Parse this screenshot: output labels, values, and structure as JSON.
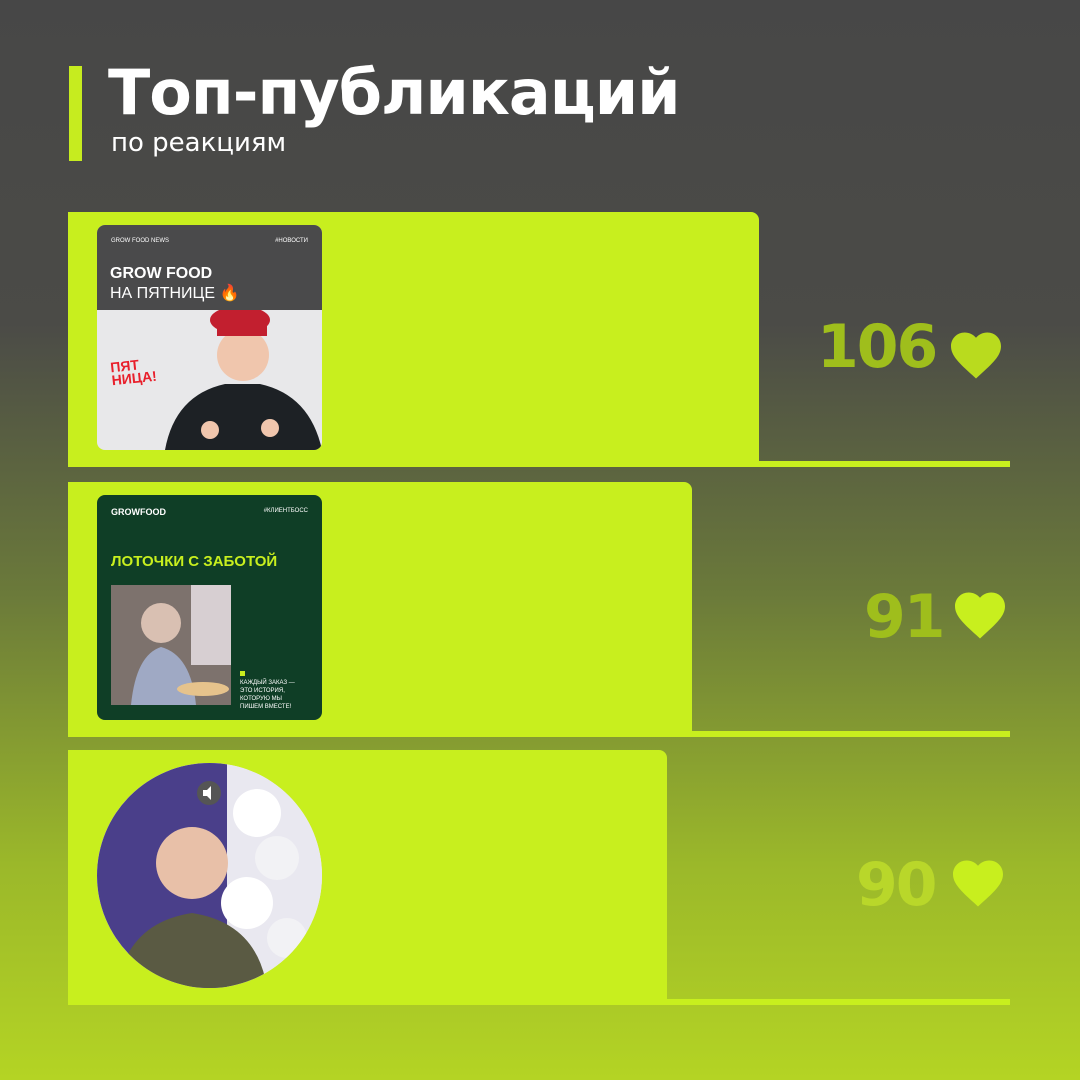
{
  "header": {
    "title": "Топ-публикаций",
    "subtitle": "по реакциям"
  },
  "posts": [
    {
      "rank": 1,
      "reactions": "106",
      "thumb": {
        "brand": "GROW FOOD NEWS",
        "tag": "#НОВОСТИ",
        "headline_1": "GROW FOOD",
        "headline_2": "НА ПЯТНИЦЕ 🔥",
        "sticker_line_1": "ПЯТ",
        "sticker_line_2": "НИЦА!"
      }
    },
    {
      "rank": 2,
      "reactions": "91",
      "thumb": {
        "brand": "GROWFOOD",
        "tag": "#КЛИЕНТБОСС",
        "headline": "ЛОТОЧКИ С ЗАБОТОЙ",
        "caption_1": "КАЖДЫЙ ЗАКАЗ —",
        "caption_2": "ЭТО ИСТОРИЯ,",
        "caption_3": "КОТОРУЮ МЫ",
        "caption_4": "ПИШЕМ ВМЕСТЕ!"
      }
    },
    {
      "rank": 3,
      "reactions": "90",
      "thumb": {
        "type": "video-circle",
        "mute_icon": "speaker-muted-icon"
      }
    }
  ],
  "icons": {
    "reaction": "heart-icon"
  },
  "colors": {
    "accent": "#c8ef1e",
    "count_first": "#9fbe1c",
    "count_second": "#9fbe1c",
    "count_third": "#b9d72a",
    "heart_first": "#b9db1e",
    "heart_second": "#c8ef1e",
    "heart_third": "#c8ef1e",
    "card_green": "#0f3e26",
    "card_dark": "#4a4a4b"
  }
}
